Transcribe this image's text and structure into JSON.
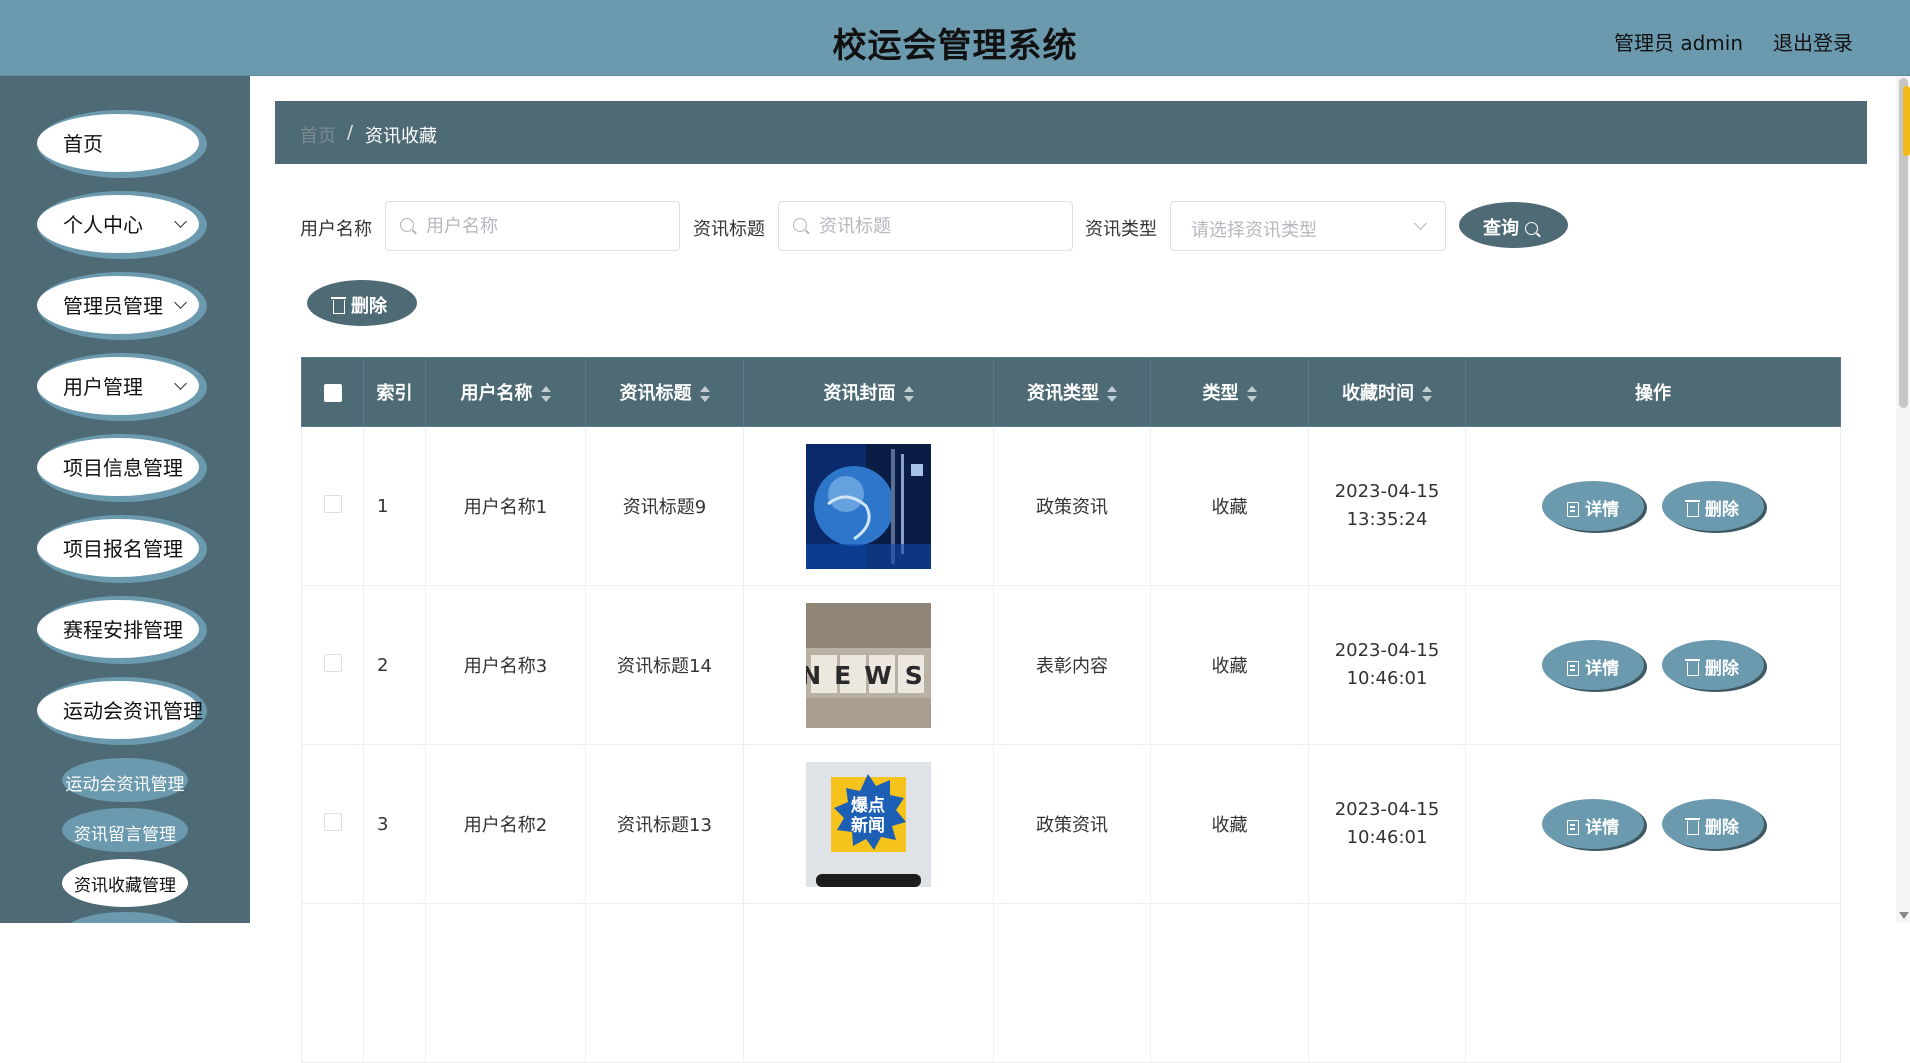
{
  "header": {
    "title": "校运会管理系统",
    "user": "管理员 admin",
    "logout": "退出登录"
  },
  "sidebar": {
    "items": [
      {
        "label": "首页"
      },
      {
        "label": "个人中心"
      },
      {
        "label": "管理员管理"
      },
      {
        "label": "用户管理"
      },
      {
        "label": "项目信息管理"
      },
      {
        "label": "项目报名管理"
      },
      {
        "label": "赛程安排管理"
      },
      {
        "label": "运动会资讯管理"
      }
    ],
    "sub_items": [
      {
        "label": "运动会资讯管理"
      },
      {
        "label": "资讯留言管理"
      },
      {
        "label": "资讯收藏管理"
      }
    ]
  },
  "breadcrumb": {
    "home": "首页",
    "separator": "/",
    "current": "资讯收藏"
  },
  "search": {
    "username_label": "用户名称",
    "username_placeholder": "用户名称",
    "title_label": "资讯标题",
    "title_placeholder": "资讯标题",
    "type_label": "资讯类型",
    "type_placeholder": "请选择资讯类型",
    "query_button": "查询"
  },
  "toolbar": {
    "delete_button": "删除"
  },
  "table": {
    "headers": [
      "索引",
      "用户名称",
      "资讯标题",
      "资讯封面",
      "资讯类型",
      "类型",
      "收藏时间",
      "操作"
    ],
    "rows": [
      {
        "index": "1",
        "username": "用户名称1",
        "title": "资讯标题9",
        "cover": "globe-image",
        "news_type": "政策资讯",
        "type": "收藏",
        "time": "2023-04-15 13:35:24"
      },
      {
        "index": "2",
        "username": "用户名称3",
        "title": "资讯标题14",
        "cover": "news-blocks-image",
        "news_type": "表彰内容",
        "type": "收藏",
        "time": "2023-04-15 10:46:01"
      },
      {
        "index": "3",
        "username": "用户名称2",
        "title": "资讯标题13",
        "cover": "breaking-news-image",
        "news_type": "政策资讯",
        "type": "收藏",
        "time": "2023-04-15 10:46:01"
      }
    ],
    "detail_button": "详情",
    "delete_button": "删除",
    "cover_text": {
      "news": "NEWS",
      "breaking_line1": "爆点",
      "breaking_line2": "新闻"
    }
  },
  "colors": {
    "header_bg": "#6b9aae",
    "sidebar_bg": "#4d6a75",
    "accent": "#4d6a75",
    "button_light": "#6b9aae"
  }
}
